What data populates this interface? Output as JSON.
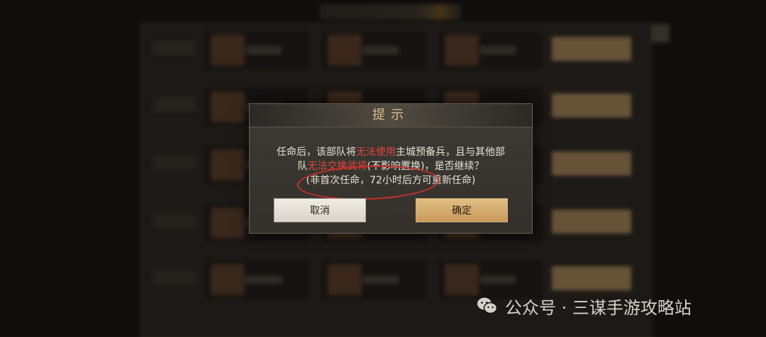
{
  "dialog": {
    "title": "提示",
    "line1_pre": "任命后，该部队将",
    "line1_warn": "无法使用",
    "line1_post": "主城预备兵，且与其他部",
    "line2_pre": "队",
    "line2_warn": "无法交换武将",
    "line2_post": "(不影响置换)，是否继续？",
    "line3": "(非首次任命，72小时后方可重新任命)",
    "cancel_label": "取消",
    "confirm_label": "确定"
  },
  "watermark": {
    "text": "公众号 · 三谋手游攻略站",
    "icon": "wechat-icon"
  },
  "colors": {
    "warning": "#e0463a",
    "title": "#d8c08a",
    "confirm_button": "#d4ab6e",
    "annotation_circle": "#c8302a"
  }
}
